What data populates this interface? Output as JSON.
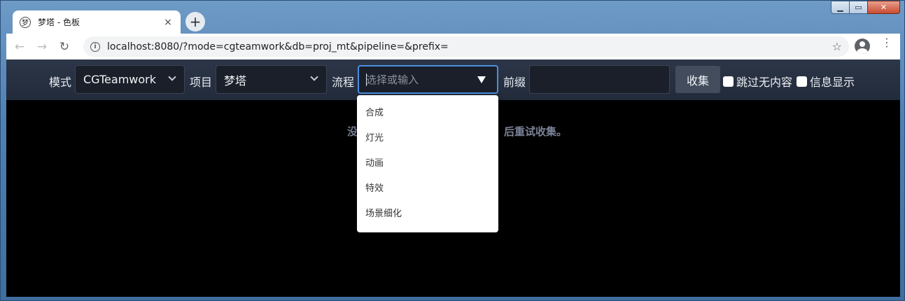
{
  "browser": {
    "tab_title": "梦塔 - 色板",
    "tab_favicon": "梦",
    "url": "localhost:8080/?mode=cgteamwork&db=proj_mt&pipeline=&prefix=",
    "close_glyph": "×",
    "new_tab_glyph": "+",
    "back_glyph": "←",
    "forward_glyph": "→",
    "reload_glyph": "↻",
    "info_glyph": "i",
    "star_glyph": "☆",
    "menu_glyph": "⋮",
    "win_min": "▁",
    "win_max": "▭",
    "win_close": "✕"
  },
  "controls": {
    "mode_label": "模式",
    "mode_value": "CGTeamwork",
    "project_label": "项目",
    "project_value": "梦塔",
    "pipeline_label": "流程",
    "pipeline_placeholder": "选择或输入",
    "prefix_label": "前缀",
    "prefix_value": "",
    "collect_button": "收集",
    "skip_empty_label": "跳过无内容",
    "show_info_label": "信息显示"
  },
  "message": {
    "left": "没",
    "right": "后重试收集。"
  },
  "pipeline_options": [
    "合成",
    "灯光",
    "动画",
    "特效",
    "场景细化"
  ],
  "colors": {
    "accent": "#4a8fe0",
    "header_bg": "#2c3648",
    "page_bg": "#000000"
  }
}
